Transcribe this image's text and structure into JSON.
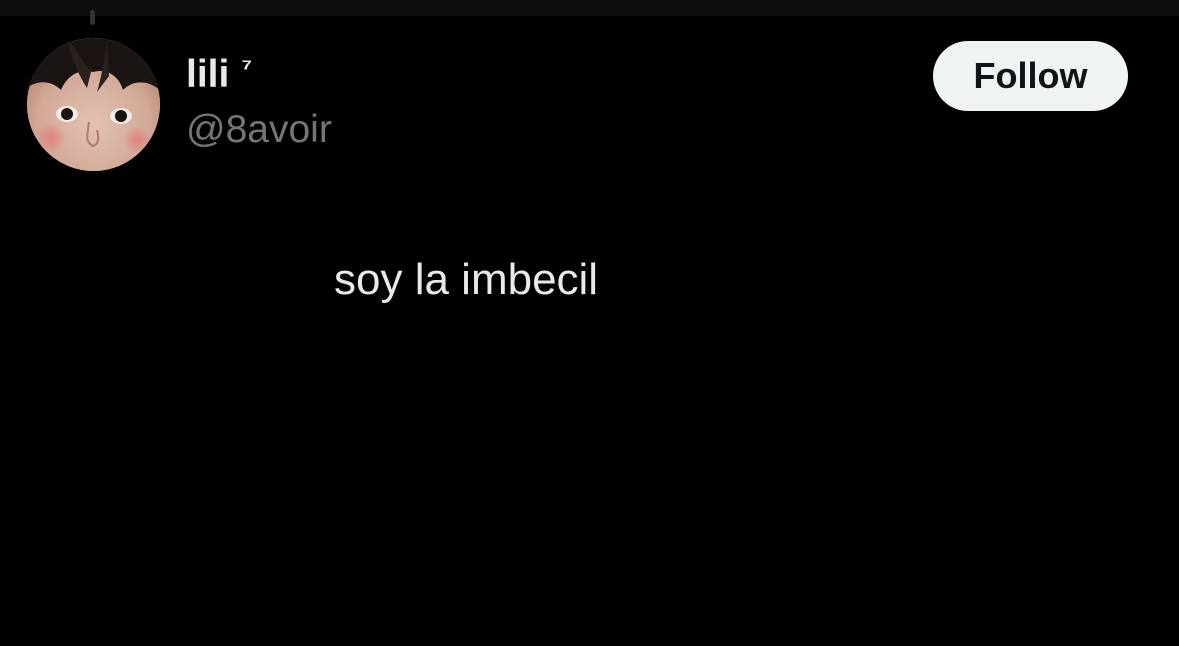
{
  "tweet": {
    "author": {
      "display_name": "lili",
      "badge": "⁷",
      "handle": "@8avoir",
      "avatar_icon": "user-avatar-photo"
    },
    "follow_label": "Follow",
    "text": "soy la imbecil"
  },
  "colors": {
    "background": "#000000",
    "primary_text": "#e7e9ea",
    "secondary_text": "#71767b",
    "follow_button_bg": "#eff3f4",
    "follow_button_text": "#0f1419"
  }
}
